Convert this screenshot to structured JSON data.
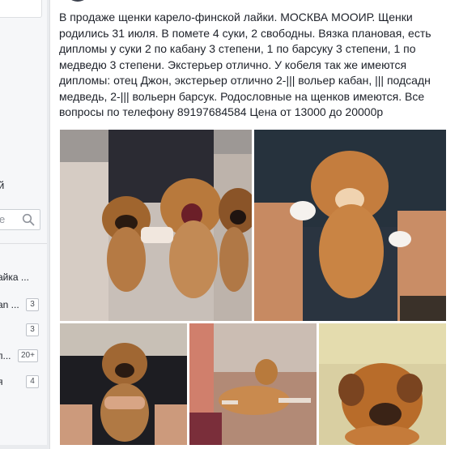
{
  "sidebar": {
    "heading": "й",
    "search": {
      "placeholder": "е"
    },
    "items": [
      {
        "label": "айка ...",
        "badge": ""
      },
      {
        "label": "an ...",
        "badge": "3"
      },
      {
        "label": "",
        "badge": "3"
      },
      {
        "label": "п...",
        "badge": "20+"
      },
      {
        "label": "я",
        "badge": "4"
      }
    ]
  },
  "post": {
    "text": "В продаже щенки карело-финской лайки. МОСКВА МООИР. Щенки родились 31 июля. В помете 4 суки, 2 свободны. Вязка плановая, есть дипломы у суки 2 по кабану 3 степени, 1 по барсуку 3 степени, 1 по медведю 3 степени. Экстерьер отлично. У кобеля так же имеются дипломы: отец Джон, экстерьер отлично 2-||| вольер кабан, ||| подсадн медведь, 2-||| вольерн барсук. Родословные на щенков имеются. Все вопросы по телефону 89197684584 Цена от 13000 до 20000р",
    "photos": [
      {
        "name": "three-puppies-held"
      },
      {
        "name": "puppy-held-up"
      },
      {
        "name": "puppy-held-dark-shirt"
      },
      {
        "name": "adult-dog-lying"
      },
      {
        "name": "puppy-closeup"
      }
    ]
  },
  "colors": {
    "page_bg": "#e9ebee",
    "card_bg": "#ffffff",
    "text": "#1d2129",
    "border": "#dddfe2"
  }
}
